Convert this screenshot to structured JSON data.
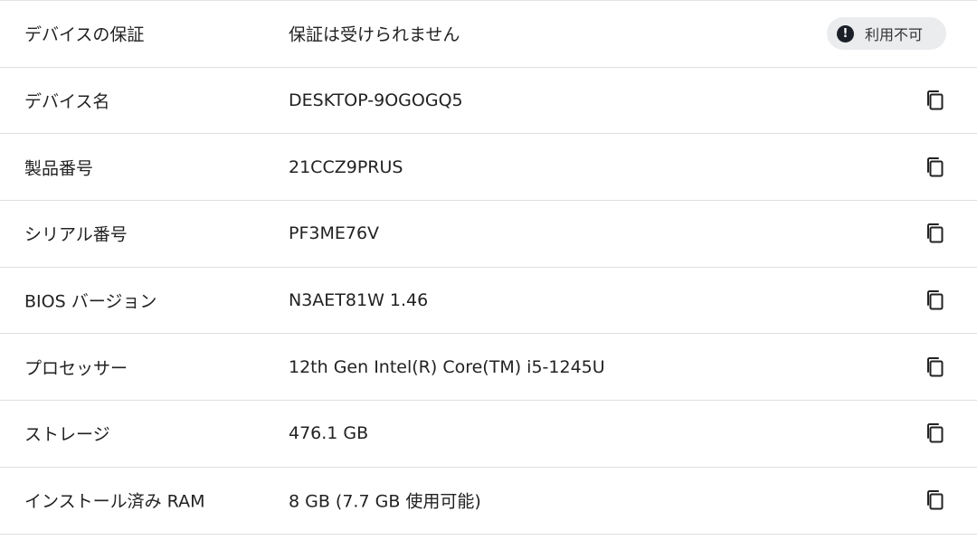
{
  "rows": [
    {
      "label": "デバイスの保証",
      "value": "保証は受けられません",
      "badge": {
        "text": "利用不可",
        "icon": "exclamation-icon"
      }
    },
    {
      "label": "デバイス名",
      "value": "DESKTOP-9OGOGQ5",
      "action_icon": "copy-icon"
    },
    {
      "label": "製品番号",
      "value": "21CCZ9PRUS",
      "action_icon": "copy-icon"
    },
    {
      "label": "シリアル番号",
      "value": "PF3ME76V",
      "action_icon": "copy-icon"
    },
    {
      "label": "BIOS バージョン",
      "value": "N3AET81W 1.46",
      "action_icon": "copy-icon"
    },
    {
      "label": "プロセッサー",
      "value": "12th Gen Intel(R) Core(TM) i5-1245U",
      "action_icon": "copy-icon"
    },
    {
      "label": "ストレージ",
      "value": "476.1 GB",
      "action_icon": "copy-icon"
    },
    {
      "label": "インストール済み RAM",
      "value": "8 GB (7.7 GB 使用可能)",
      "action_icon": "copy-icon"
    }
  ],
  "colors": {
    "divider": "#dcdfe3",
    "badge_bg": "#eaecee",
    "badge_icon_bg": "#1b1f27",
    "text": "#222222"
  }
}
